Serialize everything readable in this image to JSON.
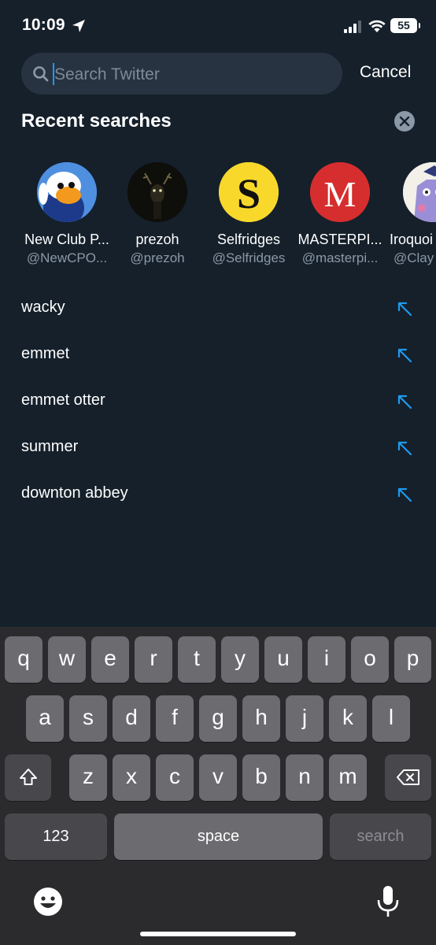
{
  "status_bar": {
    "time": "10:09",
    "battery": "55"
  },
  "search": {
    "placeholder": "Search Twitter",
    "value": "",
    "cancel_label": "Cancel"
  },
  "recent": {
    "title": "Recent searches",
    "accounts": [
      {
        "name": "New Club P...",
        "handle": "@NewCPO..."
      },
      {
        "name": "prezoh",
        "handle": "@prezoh"
      },
      {
        "name": "Selfridges",
        "handle": "@Selfridges"
      },
      {
        "name": "MASTERPI...",
        "handle": "@masterpi..."
      },
      {
        "name": "Iroquoi",
        "handle": "@Clay"
      }
    ],
    "terms": [
      "wacky",
      "emmet",
      "emmet otter",
      "summer",
      "downton abbey"
    ]
  },
  "keyboard": {
    "row1": [
      "q",
      "w",
      "e",
      "r",
      "t",
      "y",
      "u",
      "i",
      "o",
      "p"
    ],
    "row2": [
      "a",
      "s",
      "d",
      "f",
      "g",
      "h",
      "j",
      "k",
      "l"
    ],
    "row3": [
      "z",
      "x",
      "c",
      "v",
      "b",
      "n",
      "m"
    ],
    "numbers_label": "123",
    "space_label": "space",
    "search_label": "search"
  },
  "colors": {
    "background": "#15202b",
    "accent": "#1d9bf0",
    "secondary_text": "#8b98a5"
  }
}
